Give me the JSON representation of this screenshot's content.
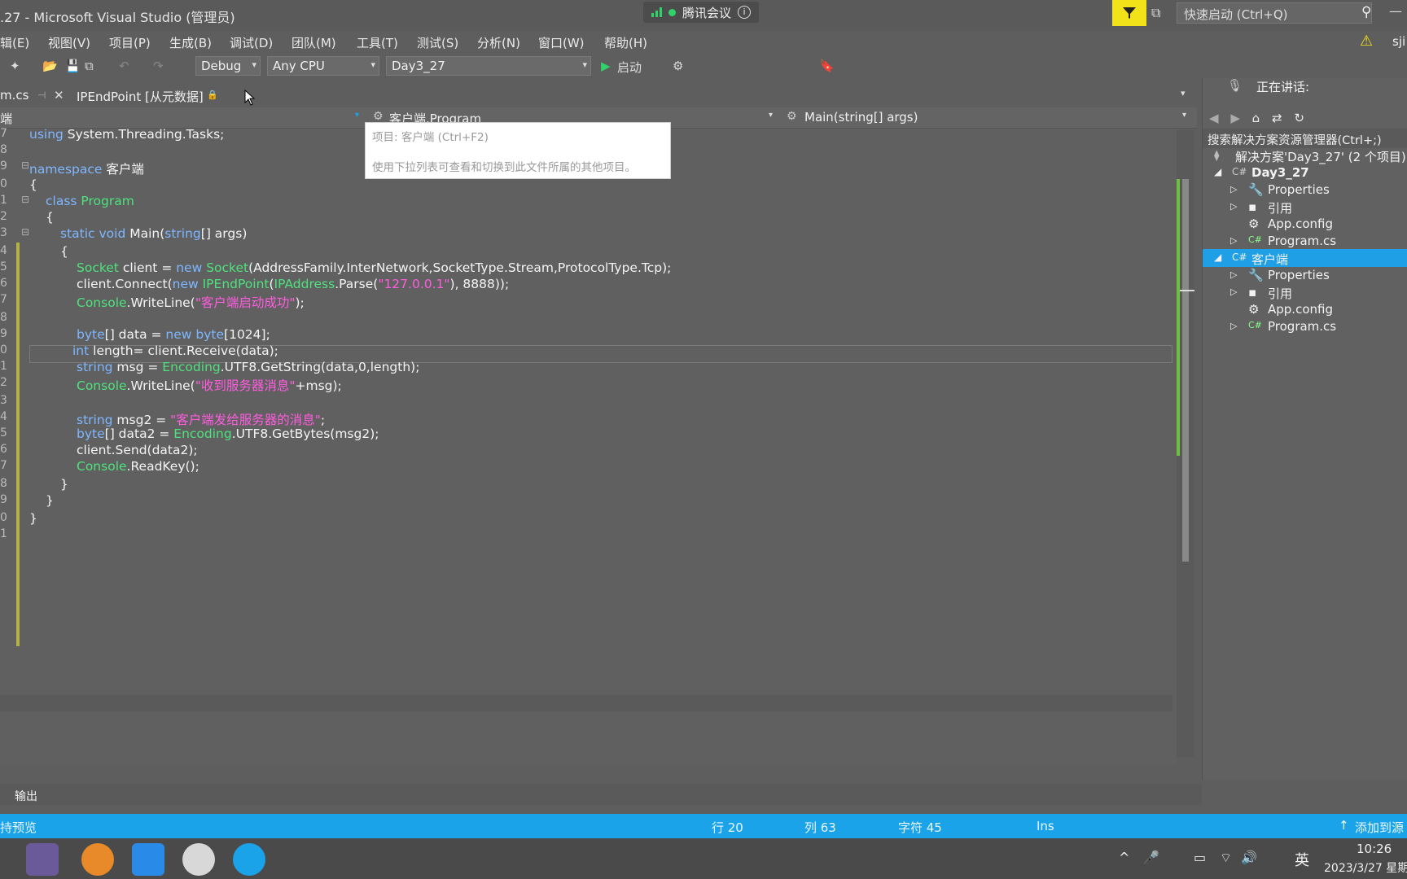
{
  "window": {
    "title": ".27 - Microsoft Visual Studio (管理员)"
  },
  "meeting": {
    "label": "腾讯会议",
    "info_icon": "info-icon"
  },
  "quick_launch": {
    "placeholder": "快速启动 (Ctrl+Q)"
  },
  "user": {
    "initials": "sji"
  },
  "menu": [
    "辑(E)",
    "视图(V)",
    "项目(P)",
    "生成(B)",
    "调试(D)",
    "团队(M)",
    "工具(T)",
    "测试(S)",
    "分析(N)",
    "窗口(W)",
    "帮助(H)"
  ],
  "toolbar": {
    "config": "Debug",
    "platform": "Any CPU",
    "startup_project": "Day3_27",
    "start_label": "启动"
  },
  "tabs": {
    "tab1": "m.cs",
    "tab2": "IPEndPoint [从元数据]"
  },
  "navbar": {
    "left": "端",
    "middle": "客户端.Program",
    "right": "Main(string[] args)"
  },
  "tooltip": {
    "line1": "项目: 客户端 (Ctrl+F2)",
    "line2": "使用下拉列表可查看和切换到此文件所属的其他项目。"
  },
  "code": {
    "line_numbers": [
      "7",
      "8",
      "9",
      "0",
      "1",
      "2",
      "3",
      "4",
      "5",
      "6",
      "7",
      "8",
      "9",
      "0",
      "1",
      "2",
      "3",
      "4",
      "5",
      "6",
      "7",
      "8",
      "9",
      "0",
      "1"
    ],
    "using_kw": "using",
    "using_rest": " System.Threading.Tasks;",
    "ns_kw": "namespace",
    "ns_name": " 客户端",
    "brace_open": "{",
    "brace_close": "}",
    "class_kw": "class",
    "class_name": " Program",
    "static_kw": "static void",
    "main_sig": " Main(",
    "string_kw": "string",
    "main_args": "[] args)",
    "l_socket_1": "Socket",
    "l_socket_2": " client = ",
    "l_socket_3": "new",
    "l_socket_4": " Socket",
    "l_socket_5": "(AddressFamily.InterNetwork,SocketType.Stream,ProtocolType.Tcp);",
    "l_conn_1": "client.Connect(",
    "l_conn_2": "new",
    "l_conn_3": " IPEndPoint",
    "l_conn_4": "(",
    "l_conn_5": "IPAddress",
    "l_conn_6": ".Parse(",
    "l_conn_7": "\"127.0.0.1\"",
    "l_conn_8": "), 8888));",
    "l_con1_1": "Console",
    "l_con1_2": ".WriteLine(",
    "l_con1_3": "\"客户端启动成功\"",
    "l_con1_4": ");",
    "l_byte_1": "byte",
    "l_byte_2": "[] data = ",
    "l_byte_3": "new",
    "l_byte_4": " byte",
    "l_byte_5": "[1024];",
    "l_int_1": "int",
    "l_int_2": " length= client.Receive(data);",
    "l_msg_1": "string",
    "l_msg_2": " msg = ",
    "l_msg_3": "Encoding",
    "l_msg_4": ".UTF8.GetString(data,0,length);",
    "l_con2_1": "Console",
    "l_con2_2": ".WriteLine(",
    "l_con2_3": "\"收到服务器消息\"",
    "l_con2_4": "+msg);",
    "l_msg2_1": "string",
    "l_msg2_2": " msg2 = ",
    "l_msg2_3": "\"客户端发给服务器的消息\"",
    "l_msg2_4": ";",
    "l_data2_1": "byte",
    "l_data2_2": "[] data2 = ",
    "l_data2_3": "Encoding",
    "l_data2_4": ".UTF8.GetBytes(msg2);",
    "l_send": "client.Send(data2);",
    "l_readkey_1": "Console",
    "l_readkey_2": ".ReadKey();"
  },
  "solution_explorer": {
    "speaking_label": "正在讲话:",
    "search_placeholder": "搜索解决方案资源管理器(Ctrl+;)",
    "solution": "解决方案'Day3_27' (2 个项目)",
    "proj1": "Day3_27",
    "proj2": "客户端",
    "properties": "Properties",
    "references": "引用",
    "app_config": "App.config",
    "program_cs": "Program.cs"
  },
  "output": {
    "label": "输出"
  },
  "status": {
    "left": "持预览",
    "line": "行 20",
    "col": "列 63",
    "char": "字符 45",
    "ins": "Ins",
    "add_source": "添加到源"
  },
  "taskbar": {
    "ime": "英",
    "time": "10:26",
    "date": "2023/3/27 星期"
  },
  "colors": {
    "accent": "#1aa3e8",
    "type": "#4ee27d",
    "keyword": "#7fb7ff",
    "string": "#ff5ce0"
  }
}
